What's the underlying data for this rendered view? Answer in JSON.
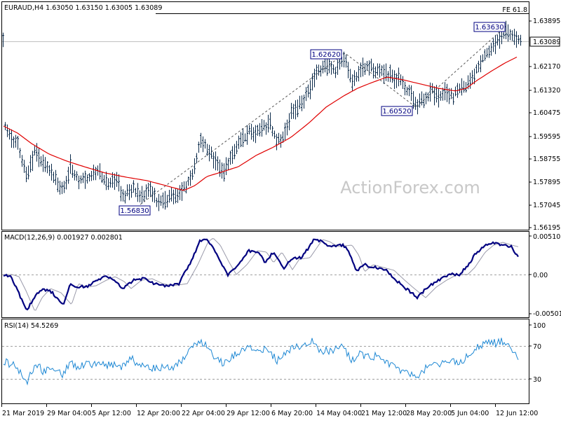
{
  "chart_data": [
    {
      "type": "candlestick",
      "title": "EURAUD,H4  1.63050 1.63150 1.63005 1.63089",
      "current_price": "1.63089",
      "yticks": [
        "1.63895",
        "1.63089",
        "1.62170",
        "1.61320",
        "1.60475",
        "1.59595",
        "1.58755",
        "1.57895",
        "1.57045",
        "1.56195"
      ],
      "xticks": [
        "21 Mar 2019",
        "29 Mar 04:00",
        "5 Apr 12:00",
        "12 Apr 20:00",
        "22 Apr 04:00",
        "29 Apr 12:00",
        "6 May 20:00",
        "14 May 04:00",
        "21 May 12:00",
        "28 May 20:00",
        "5 Jun 04:00",
        "12 Jun 12:00"
      ],
      "ylim": [
        1.5615,
        1.6415
      ],
      "ma_color": "#e00000",
      "candle_color": "#0b2a4a",
      "annotations": [
        {
          "text": "FE 61.8",
          "value": 1.6402
        },
        {
          "text": "1.56830",
          "value": 1.5683
        },
        {
          "text": "1.62620",
          "value": 1.6262
        },
        {
          "text": "1.60520",
          "value": 1.6052
        },
        {
          "text": "1.63630",
          "value": 1.6363
        }
      ],
      "watermark": "ActionForex.com"
    },
    {
      "type": "line",
      "title": "MACD(12,26,9) 0.001927 0.002801",
      "yticks": [
        "0.005108",
        "0.00",
        "-0.005019"
      ],
      "ylim": [
        -0.0066,
        0.0066
      ],
      "series": [
        {
          "name": "MACD",
          "color": "#000080"
        },
        {
          "name": "Signal",
          "color": "#9a9aaa"
        }
      ]
    },
    {
      "type": "line",
      "title": "RSI(14) 54.5269",
      "yticks": [
        "100",
        "70",
        "30"
      ],
      "ylim": [
        10,
        100
      ],
      "series": [
        {
          "name": "RSI",
          "color": "#1e88d4"
        }
      ]
    }
  ]
}
